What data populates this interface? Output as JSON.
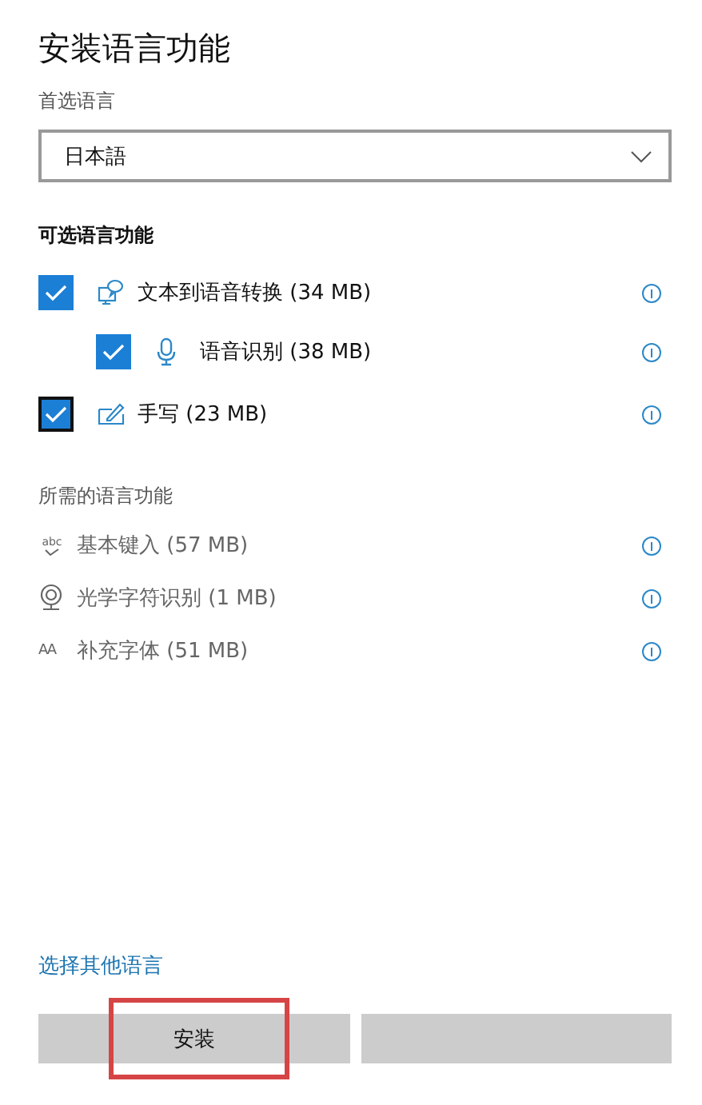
{
  "title": "安装语言功能",
  "preferred_language": {
    "label": "首选语言",
    "value": "日本語"
  },
  "optional_features": {
    "heading": "可选语言功能",
    "items": [
      {
        "label": "文本到语音转换 (34 MB)",
        "checked": true,
        "focused": false,
        "children": [
          {
            "label": "语音识别 (38 MB)",
            "checked": true,
            "focused": false
          }
        ]
      },
      {
        "label": "手写 (23 MB)",
        "checked": true,
        "focused": true
      }
    ]
  },
  "required_features": {
    "heading": "所需的语言功能",
    "items": [
      {
        "label": "基本键入 (57 MB)",
        "glyph": "abc"
      },
      {
        "label": "光学字符识别 (1 MB)"
      },
      {
        "label": "补充字体 (51 MB)",
        "glyph": "AA"
      }
    ]
  },
  "link": "选择其他语言",
  "buttons": [
    {
      "label": "安装",
      "highlighted": true
    },
    {
      "highlighted": false
    }
  ]
}
